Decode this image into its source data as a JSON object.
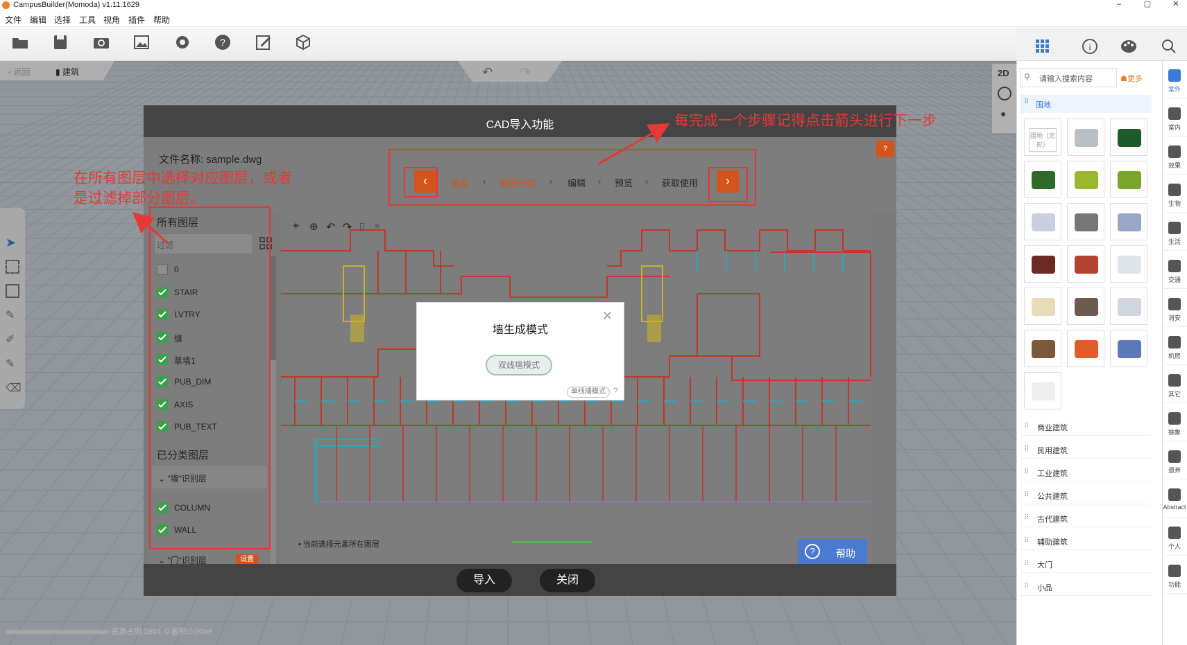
{
  "window": {
    "title": "CampusBuilder(Momoda) v1.11.1629",
    "controls": [
      "–",
      "▢",
      "✕"
    ]
  },
  "menu": [
    "文件",
    "编辑",
    "选择",
    "工具",
    "视角",
    "插件",
    "帮助"
  ],
  "toolbar": {
    "tools": [
      "open-folder-icon",
      "save-icon",
      "camera-icon",
      "image-icon",
      "gear-icon",
      "help-icon",
      "edit-icon",
      "cube-add-icon"
    ]
  },
  "nav": {
    "back_label": "返回",
    "building_label": "建筑"
  },
  "view_mode": {
    "label_2d": "2D"
  },
  "status": {
    "text": "资源占用:1904, 0  面积:0.00m²"
  },
  "right_panel": {
    "search_placeholder": "请输入搜索内容",
    "more_label": "更多",
    "active_category": "围地",
    "thumb_first_label": "围地（无形）",
    "categories": [
      "商业建筑",
      "民用建筑",
      "工业建筑",
      "公共建筑",
      "古代建筑",
      "辅助建筑",
      "大门",
      "小品"
    ]
  },
  "side_rail": [
    {
      "label": "室外",
      "icon": "building-icon",
      "active": true
    },
    {
      "label": "室内",
      "icon": "home-icon",
      "active": false
    },
    {
      "label": "效果",
      "icon": "effects-icon",
      "active": false
    },
    {
      "label": "生物",
      "icon": "creature-icon",
      "active": false
    },
    {
      "label": "生活",
      "icon": "cup-icon",
      "active": false
    },
    {
      "label": "交通",
      "icon": "car-icon",
      "active": false
    },
    {
      "label": "消安",
      "icon": "fire-icon",
      "active": false
    },
    {
      "label": "机房",
      "icon": "server-icon",
      "active": false
    },
    {
      "label": "其它",
      "icon": "more-icon",
      "active": false
    },
    {
      "label": "抽象",
      "icon": "box-icon",
      "active": false
    },
    {
      "label": "遗弃",
      "icon": "trash-icon",
      "active": false
    },
    {
      "label": "Abstract",
      "icon": "box-icon",
      "active": false
    },
    {
      "label": "个人",
      "icon": "person-icon",
      "active": false
    },
    {
      "label": "功能",
      "icon": "gear-icon",
      "active": false
    }
  ],
  "dialog": {
    "title": "CAD导入功能",
    "file_label": "文件名称: sample.dwg",
    "help_q": "?",
    "steps": [
      {
        "label": "裁剪",
        "active": true
      },
      {
        "label": "图层分类",
        "active": true
      },
      {
        "label": "编辑",
        "active": false
      },
      {
        "label": "预览",
        "active": false
      },
      {
        "label": "获取使用",
        "active": false
      }
    ],
    "all_layers_title": "所有图层",
    "filter_placeholder": "过滤",
    "layers": [
      {
        "name": "0",
        "checked": false
      },
      {
        "name": "STAIR",
        "checked": true
      },
      {
        "name": "LVTRY",
        "checked": true
      },
      {
        "name": "缝",
        "checked": true
      },
      {
        "name": "草墙1",
        "checked": true
      },
      {
        "name": "PUB_DIM",
        "checked": true
      },
      {
        "name": "AXIS",
        "checked": true
      },
      {
        "name": "PUB_TEXT",
        "checked": true
      }
    ],
    "classified_title": "已分类图层",
    "wall_group": "\"墙\"识别层",
    "wall_layers": [
      {
        "name": "COLUMN",
        "checked": true
      },
      {
        "name": "WALL",
        "checked": true
      }
    ],
    "door_group": "\"门\"识别层",
    "set_label": "设置",
    "cad_status": "• 当前选择元素所在图层",
    "help_label": "帮助",
    "import_label": "导入",
    "close_label": "关闭"
  },
  "modal": {
    "title": "墙生成模式",
    "double_wall": "双线墙模式",
    "single_wall": "单线墙模式",
    "q": "?"
  },
  "annotations": {
    "top_note": "每完成一个步骤记得点击箭头进行下一步",
    "left_note_line1": "在所有图层中选择对应图层，或者",
    "left_note_line2": "是过滤掉部分图层。"
  },
  "colors": {
    "accent_orange": "#d3541c",
    "annotation_red": "#e53935",
    "check_green": "#3aa04a",
    "help_blue": "#4a7bd1"
  }
}
